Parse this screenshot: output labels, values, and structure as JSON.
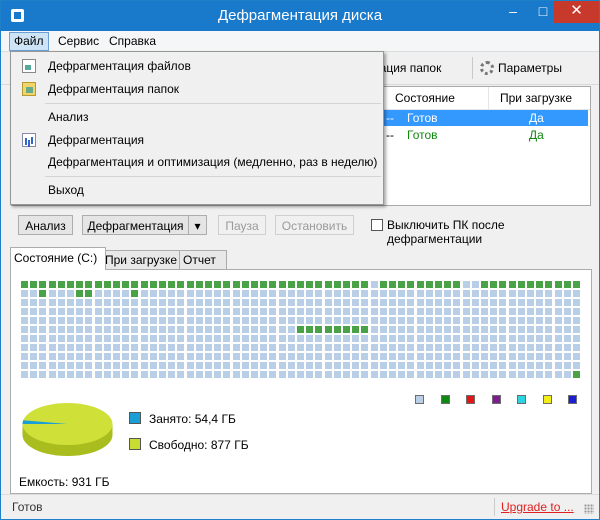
{
  "window": {
    "title": "Дефрагментация диска",
    "minimize": "–",
    "maximize": "□",
    "close": "✕"
  },
  "menu": {
    "file": "Файл",
    "service": "Сервис",
    "help": "Справка"
  },
  "toolbar": {
    "defrag_folders": "ентация папок",
    "params": "Параметры"
  },
  "drives": {
    "columns": {
      "state": "Состояние",
      "on_boot": "При загрузке"
    },
    "rows": [
      {
        "mark": "--",
        "state": "Готов",
        "on_boot": "Да"
      },
      {
        "mark": "--",
        "state": "Готов",
        "on_boot": "Да"
      }
    ]
  },
  "file_menu": {
    "items": [
      {
        "label": "Дефрагментация файлов",
        "icon": "document-icon"
      },
      {
        "label": "Дефрагментация папок",
        "icon": "folder-icon"
      },
      {
        "label": "Анализ",
        "icon": ""
      },
      {
        "label": "Дефрагментация",
        "icon": "chart-icon"
      },
      {
        "label": "Дефрагментация и оптимизация (медленно, раз в неделю)",
        "icon": ""
      },
      {
        "label": "Выход",
        "icon": ""
      }
    ]
  },
  "actions": {
    "analyze": "Анализ",
    "defrag": "Дефрагментация",
    "pause": "Пауза",
    "stop": "Остановить",
    "shutdown_label": "Выключить ПК после дефрагментации",
    "shutdown_checked": false
  },
  "tabs": {
    "state": "Состояние (C:)",
    "on_boot": "При загрузке",
    "report": "Отчет"
  },
  "colors": {
    "cell_free": "#b9cfe7",
    "cell_green": "#49a346",
    "legend": [
      "#b9cfe7",
      "#118811",
      "#e61414",
      "#7d1d8f",
      "#2ed3e0",
      "#f2ee16",
      "#1c1ed6"
    ],
    "used": "#1a9ed6",
    "free": "#c8dc32"
  },
  "disk_map": {
    "cols": 61,
    "rows": 11,
    "green_cells": [
      [
        0,
        0
      ],
      [
        0,
        1
      ],
      [
        0,
        2
      ],
      [
        0,
        3
      ],
      [
        0,
        4
      ],
      [
        0,
        5
      ],
      [
        0,
        6
      ],
      [
        0,
        7
      ],
      [
        0,
        8
      ],
      [
        0,
        9
      ],
      [
        0,
        10
      ],
      [
        0,
        11
      ],
      [
        0,
        12
      ],
      [
        0,
        13
      ],
      [
        0,
        14
      ],
      [
        0,
        15
      ],
      [
        0,
        16
      ],
      [
        0,
        17
      ],
      [
        0,
        18
      ],
      [
        0,
        19
      ],
      [
        0,
        20
      ],
      [
        0,
        21
      ],
      [
        0,
        22
      ],
      [
        0,
        23
      ],
      [
        0,
        24
      ],
      [
        0,
        25
      ],
      [
        0,
        26
      ],
      [
        0,
        27
      ],
      [
        0,
        28
      ],
      [
        0,
        29
      ],
      [
        0,
        30
      ],
      [
        0,
        31
      ],
      [
        0,
        32
      ],
      [
        0,
        33
      ],
      [
        0,
        34
      ],
      [
        0,
        35
      ],
      [
        0,
        36
      ],
      [
        0,
        37
      ],
      [
        0,
        39
      ],
      [
        0,
        40
      ],
      [
        0,
        41
      ],
      [
        0,
        42
      ],
      [
        0,
        43
      ],
      [
        0,
        44
      ],
      [
        0,
        45
      ],
      [
        0,
        46
      ],
      [
        0,
        47
      ],
      [
        0,
        50
      ],
      [
        0,
        51
      ],
      [
        0,
        52
      ],
      [
        0,
        53
      ],
      [
        0,
        54
      ],
      [
        0,
        55
      ],
      [
        0,
        56
      ],
      [
        0,
        57
      ],
      [
        0,
        58
      ],
      [
        0,
        59
      ],
      [
        0,
        60
      ],
      [
        1,
        2
      ],
      [
        1,
        6
      ],
      [
        1,
        7
      ],
      [
        1,
        12
      ],
      [
        5,
        30
      ],
      [
        5,
        31
      ],
      [
        5,
        32
      ],
      [
        5,
        33
      ],
      [
        5,
        34
      ],
      [
        5,
        35
      ],
      [
        5,
        36
      ],
      [
        5,
        37
      ],
      [
        10,
        60
      ]
    ]
  },
  "usage": {
    "used_label": "Занято: 54,4 ГБ",
    "free_label": "Свободно: 877 ГБ",
    "used_fraction": 0.058,
    "capacity": "Емкость: 931 ГБ"
  },
  "status": {
    "text": "Готов",
    "upgrade": "Upgrade to ..."
  }
}
